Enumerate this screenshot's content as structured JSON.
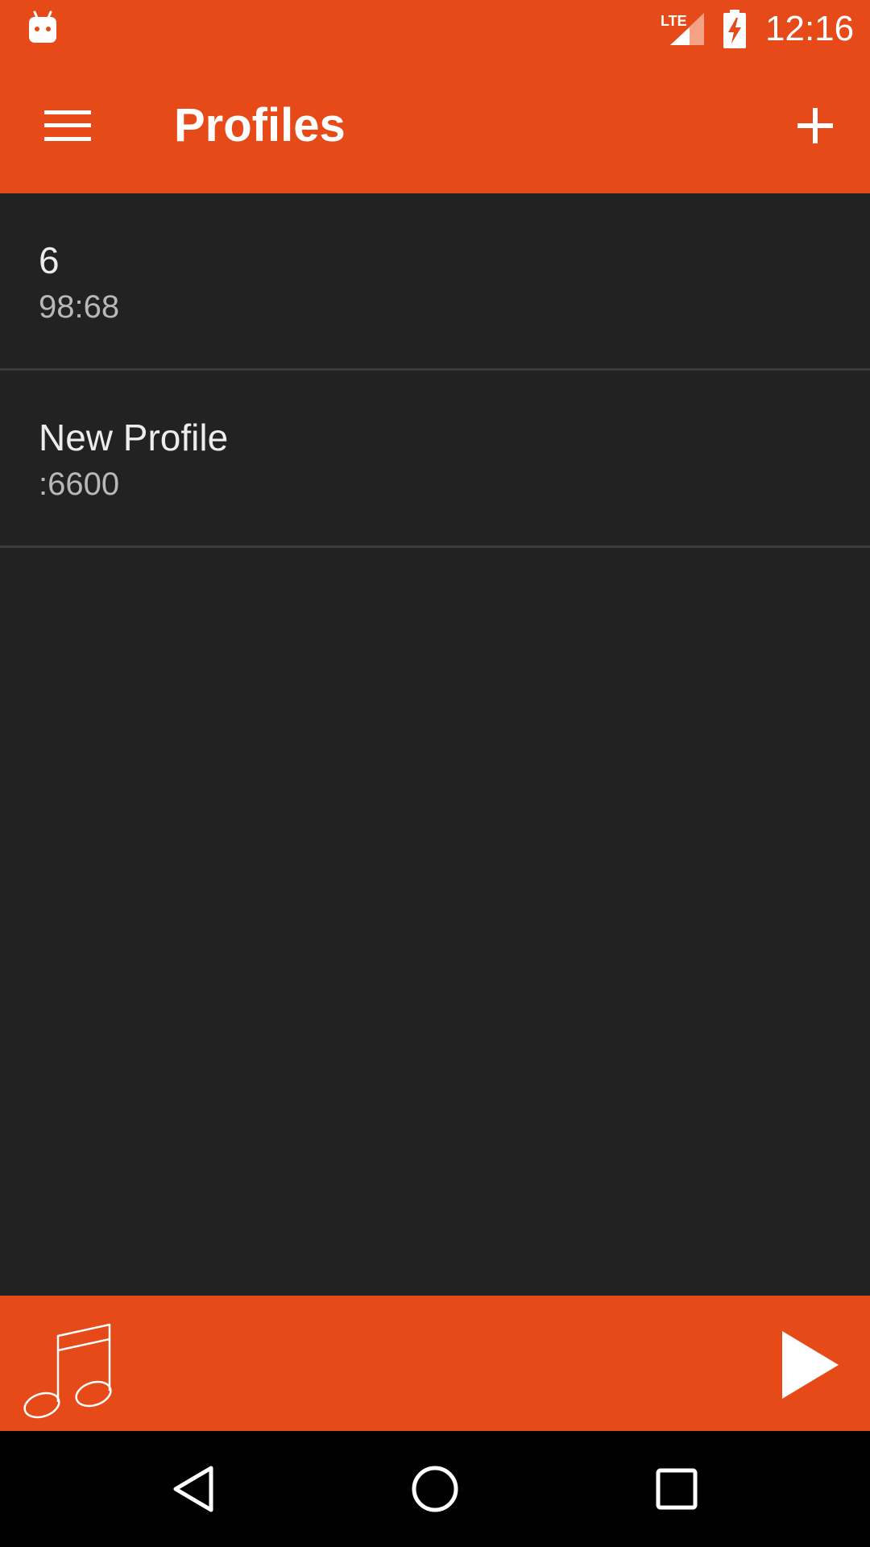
{
  "status_bar": {
    "time": "12:16",
    "network_label": "LTE",
    "icons": [
      "android-debug-icon",
      "lte-signal-icon",
      "battery-charging-icon"
    ]
  },
  "app_bar": {
    "title": "Profiles",
    "menu_icon": "hamburger-menu-icon",
    "add_icon": "plus-icon"
  },
  "profiles": [
    {
      "name": "6",
      "address": "98:68"
    },
    {
      "name": "New Profile",
      "address": ":6600"
    }
  ],
  "player_bar": {
    "music_icon": "music-note-icon",
    "play_icon": "play-icon"
  },
  "nav_bar": {
    "icons": [
      "back-icon",
      "home-icon",
      "recents-icon"
    ]
  },
  "colors": {
    "accent": "#E64A19",
    "background": "#222222",
    "divider": "#3c3c3c",
    "primary_text": "#ececec",
    "secondary_text": "#b8b8b8"
  }
}
